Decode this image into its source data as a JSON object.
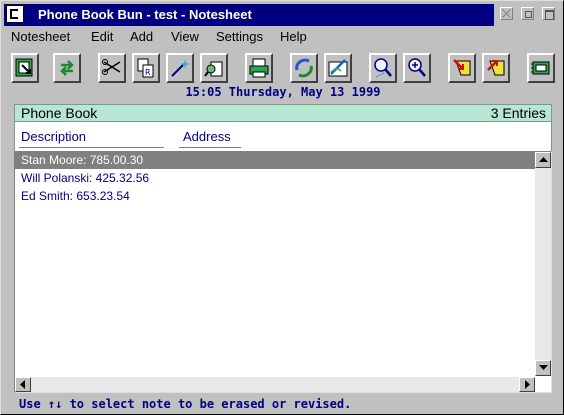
{
  "window": {
    "title": "Phone Book Bun - test - Notesheet"
  },
  "menu": [
    "Notesheet",
    "Edit",
    "Add",
    "View",
    "Settings",
    "Help"
  ],
  "toolbar_icons": [
    "exit-icon",
    "undo-icon",
    "cut-icon",
    "copy-icon",
    "magic-wand-icon",
    "find-icon",
    "print-icon",
    "dial-phone-icon",
    "note-edit-icon",
    "zoom-out-icon",
    "zoom-in-icon",
    "prev-note-icon",
    "next-note-icon",
    "book-icon"
  ],
  "datetime": "15:05 Thursday, May 13 1999",
  "panel": {
    "title": "Phone Book",
    "count": "3 Entries",
    "columns": {
      "description": "Description",
      "address": "Address"
    }
  },
  "entries": [
    {
      "text": "Stan Moore: 785.00.30",
      "selected": true
    },
    {
      "text": "Will Polanski: 425.32.56",
      "selected": false
    },
    {
      "text": "Ed Smith: 653.23.54",
      "selected": false
    }
  ],
  "status": "Use ↑↓ to select note to be erased or revised.",
  "colors": {
    "titlebar": "#000080",
    "panel_header": "#b7e6d2",
    "text_accent": "#000080",
    "selection": "#808080"
  }
}
